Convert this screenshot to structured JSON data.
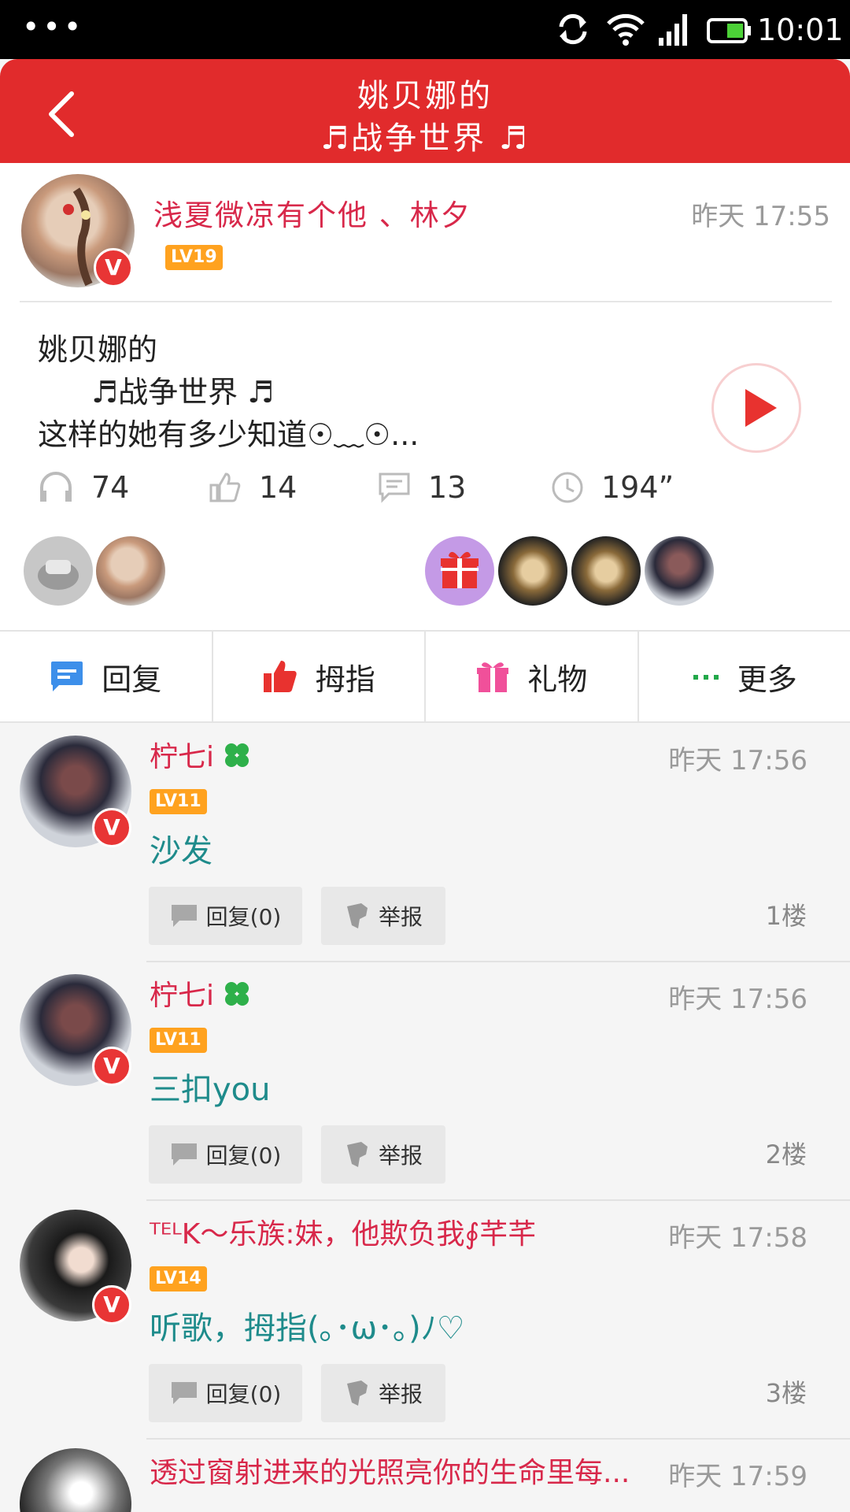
{
  "status_bar": {
    "time": "10:01",
    "dots": "•••"
  },
  "header": {
    "back_icon": "chevron-left-icon",
    "title_line1": "姚贝娜的",
    "title_line2": "♬战争世界 ♬"
  },
  "post": {
    "author": "浅夏微凉有个他 、林夕",
    "level": "LV19",
    "time": "昨天 17:55",
    "title_line1": "姚贝娜的",
    "title_line2": "♬战争世界 ♬",
    "title_line3": "这样的她有多少知道☉﹏☉...",
    "stats": {
      "listens": "74",
      "likes": "14",
      "comments": "13",
      "duration": "194”"
    }
  },
  "actions": {
    "reply": "回复",
    "thumb": "拇指",
    "gift": "礼物",
    "more": "更多"
  },
  "replies": [
    {
      "name": "柠七i",
      "level": "LV11",
      "time": "昨天 17:56",
      "text": "沙发",
      "reply_btn": "回复(0)",
      "report_btn": "举报",
      "floor": "1楼"
    },
    {
      "name": "柠七i",
      "level": "LV11",
      "time": "昨天 17:56",
      "text": "三扣you",
      "reply_btn": "回复(0)",
      "report_btn": "举报",
      "floor": "2楼"
    },
    {
      "name": "ᵀᴱᴸK～乐族:妹，他欺负我∮芊芊",
      "level": "LV14",
      "time": "昨天 17:58",
      "text": "听歌，拇指(｡･ω･｡)ﾉ♡",
      "reply_btn": "回复(0)",
      "report_btn": "举报",
      "floor": "3楼"
    },
    {
      "name": "透过窗射进来的光照亮你的生命里每...",
      "time": "昨天 17:59"
    }
  ],
  "colors": {
    "header_red": "#e12b2c",
    "name_pink": "#d8284a",
    "reply_teal": "#1e8b8b",
    "level_orange": "#ffa21f"
  }
}
